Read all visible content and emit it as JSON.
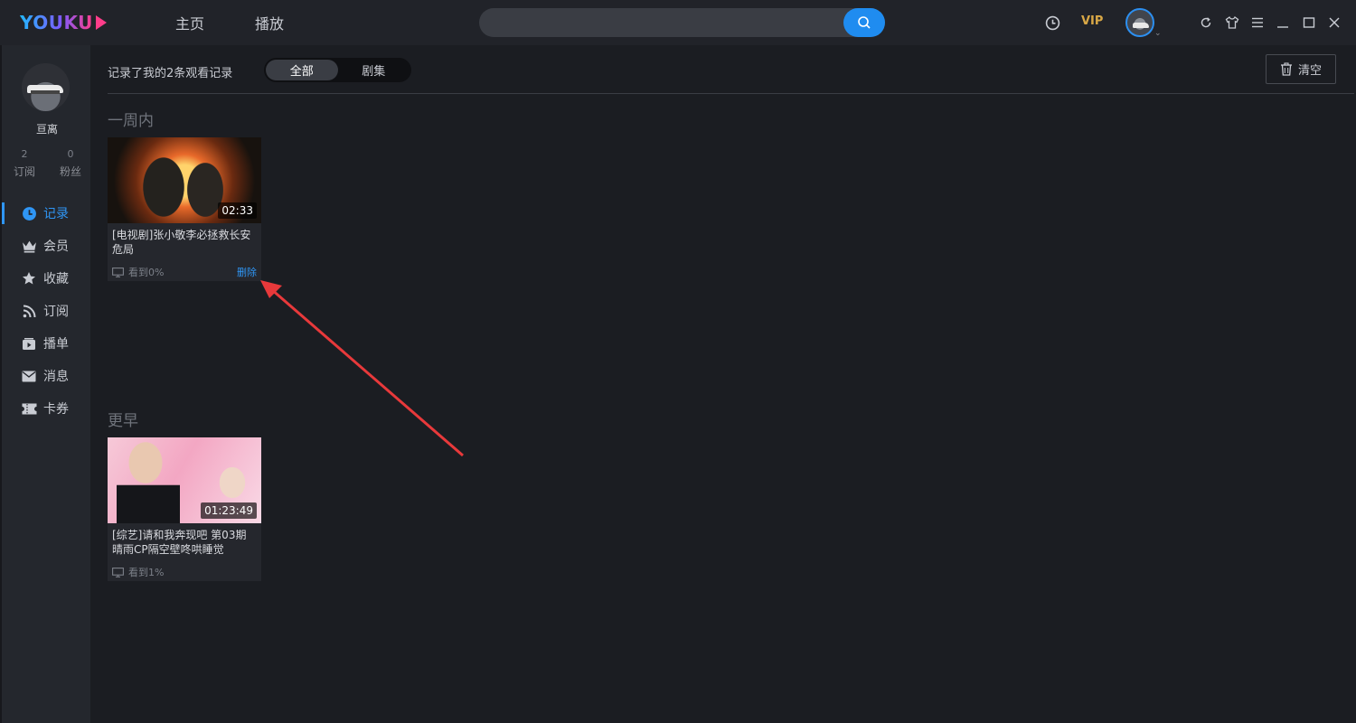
{
  "app": {
    "logo": "YOUKU"
  },
  "nav": {
    "home": "主页",
    "play": "播放"
  },
  "search": {
    "placeholder": ""
  },
  "topbar": {
    "vip": "VIP"
  },
  "user": {
    "name": "亘离",
    "subscriptions_count": "2",
    "subscriptions_label": "订阅",
    "fans_count": "0",
    "fans_label": "粉丝"
  },
  "sidebar": {
    "items": [
      {
        "label": "记录",
        "icon": "clock-icon",
        "active": true
      },
      {
        "label": "会员",
        "icon": "crown-icon"
      },
      {
        "label": "收藏",
        "icon": "star-icon"
      },
      {
        "label": "订阅",
        "icon": "rss-icon"
      },
      {
        "label": "播单",
        "icon": "playlist-icon"
      },
      {
        "label": "消息",
        "icon": "mail-icon"
      },
      {
        "label": "卡券",
        "icon": "ticket-icon"
      }
    ]
  },
  "history": {
    "summary": "记录了我的2条观看记录",
    "filter": {
      "all": "全部",
      "series": "剧集",
      "selected": "全部"
    },
    "clear_label": "清空",
    "sections": [
      {
        "title": "一周内",
        "items": [
          {
            "title": "[电视剧]张小敬李必拯救长安危局",
            "duration": "02:33",
            "progress": "看到0%",
            "delete_label": "删除"
          }
        ]
      },
      {
        "title": "更早",
        "items": [
          {
            "title": "[综艺]请和我奔现吧 第03期 晴雨CP隔空壁咚哄睡觉",
            "duration": "01:23:49",
            "progress": "看到1%"
          }
        ]
      }
    ]
  },
  "colors": {
    "accent": "#2f96f5",
    "vip": "#d9a846",
    "annotation_arrow": "#e8393b"
  }
}
